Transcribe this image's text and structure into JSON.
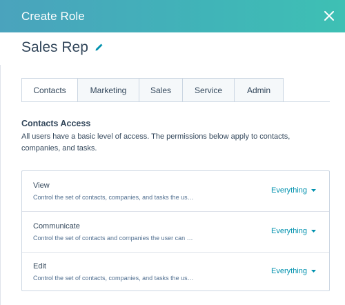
{
  "header": {
    "title": "Create Role",
    "close_icon": "close-icon",
    "gradient": [
      "#4aa3bd",
      "#3ec0b4"
    ]
  },
  "role": {
    "name": "Sales Rep",
    "edit_icon": "pencil-icon"
  },
  "tabs": [
    {
      "label": "Contacts",
      "active": true
    },
    {
      "label": "Marketing",
      "active": false
    },
    {
      "label": "Sales",
      "active": false
    },
    {
      "label": "Service",
      "active": false
    },
    {
      "label": "Admin",
      "active": false
    }
  ],
  "section": {
    "title": "Contacts Access",
    "description": "All users have a basic level of access. The permissions below apply to contacts, companies, and tasks."
  },
  "permissions": [
    {
      "name": "View",
      "description": "Control the set of contacts, companies, and tasks the us…",
      "value": "Everything"
    },
    {
      "name": "Communicate",
      "description": "Control the set of contacts and companies the user can …",
      "value": "Everything"
    },
    {
      "name": "Edit",
      "description": "Control the set of contacts, companies, and tasks the us…",
      "value": "Everything"
    }
  ],
  "colors": {
    "accent": "#0091ae",
    "text": "#33475b",
    "border": "#cbd6e2"
  }
}
